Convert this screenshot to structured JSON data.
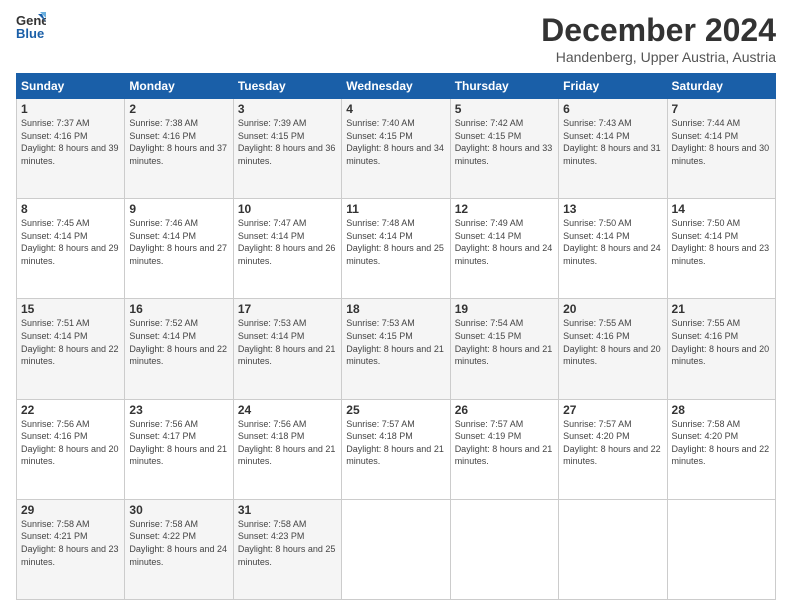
{
  "logo": {
    "line1": "General",
    "line2": "Blue"
  },
  "header": {
    "title": "December 2024",
    "subtitle": "Handenberg, Upper Austria, Austria"
  },
  "columns": [
    "Sunday",
    "Monday",
    "Tuesday",
    "Wednesday",
    "Thursday",
    "Friday",
    "Saturday"
  ],
  "weeks": [
    [
      {
        "day": "1",
        "sunrise": "7:37 AM",
        "sunset": "4:16 PM",
        "daylight": "8 hours and 39 minutes."
      },
      {
        "day": "2",
        "sunrise": "7:38 AM",
        "sunset": "4:16 PM",
        "daylight": "8 hours and 37 minutes."
      },
      {
        "day": "3",
        "sunrise": "7:39 AM",
        "sunset": "4:15 PM",
        "daylight": "8 hours and 36 minutes."
      },
      {
        "day": "4",
        "sunrise": "7:40 AM",
        "sunset": "4:15 PM",
        "daylight": "8 hours and 34 minutes."
      },
      {
        "day": "5",
        "sunrise": "7:42 AM",
        "sunset": "4:15 PM",
        "daylight": "8 hours and 33 minutes."
      },
      {
        "day": "6",
        "sunrise": "7:43 AM",
        "sunset": "4:14 PM",
        "daylight": "8 hours and 31 minutes."
      },
      {
        "day": "7",
        "sunrise": "7:44 AM",
        "sunset": "4:14 PM",
        "daylight": "8 hours and 30 minutes."
      }
    ],
    [
      {
        "day": "8",
        "sunrise": "7:45 AM",
        "sunset": "4:14 PM",
        "daylight": "8 hours and 29 minutes."
      },
      {
        "day": "9",
        "sunrise": "7:46 AM",
        "sunset": "4:14 PM",
        "daylight": "8 hours and 27 minutes."
      },
      {
        "day": "10",
        "sunrise": "7:47 AM",
        "sunset": "4:14 PM",
        "daylight": "8 hours and 26 minutes."
      },
      {
        "day": "11",
        "sunrise": "7:48 AM",
        "sunset": "4:14 PM",
        "daylight": "8 hours and 25 minutes."
      },
      {
        "day": "12",
        "sunrise": "7:49 AM",
        "sunset": "4:14 PM",
        "daylight": "8 hours and 24 minutes."
      },
      {
        "day": "13",
        "sunrise": "7:50 AM",
        "sunset": "4:14 PM",
        "daylight": "8 hours and 24 minutes."
      },
      {
        "day": "14",
        "sunrise": "7:50 AM",
        "sunset": "4:14 PM",
        "daylight": "8 hours and 23 minutes."
      }
    ],
    [
      {
        "day": "15",
        "sunrise": "7:51 AM",
        "sunset": "4:14 PM",
        "daylight": "8 hours and 22 minutes."
      },
      {
        "day": "16",
        "sunrise": "7:52 AM",
        "sunset": "4:14 PM",
        "daylight": "8 hours and 22 minutes."
      },
      {
        "day": "17",
        "sunrise": "7:53 AM",
        "sunset": "4:14 PM",
        "daylight": "8 hours and 21 minutes."
      },
      {
        "day": "18",
        "sunrise": "7:53 AM",
        "sunset": "4:15 PM",
        "daylight": "8 hours and 21 minutes."
      },
      {
        "day": "19",
        "sunrise": "7:54 AM",
        "sunset": "4:15 PM",
        "daylight": "8 hours and 21 minutes."
      },
      {
        "day": "20",
        "sunrise": "7:55 AM",
        "sunset": "4:16 PM",
        "daylight": "8 hours and 20 minutes."
      },
      {
        "day": "21",
        "sunrise": "7:55 AM",
        "sunset": "4:16 PM",
        "daylight": "8 hours and 20 minutes."
      }
    ],
    [
      {
        "day": "22",
        "sunrise": "7:56 AM",
        "sunset": "4:16 PM",
        "daylight": "8 hours and 20 minutes."
      },
      {
        "day": "23",
        "sunrise": "7:56 AM",
        "sunset": "4:17 PM",
        "daylight": "8 hours and 21 minutes."
      },
      {
        "day": "24",
        "sunrise": "7:56 AM",
        "sunset": "4:18 PM",
        "daylight": "8 hours and 21 minutes."
      },
      {
        "day": "25",
        "sunrise": "7:57 AM",
        "sunset": "4:18 PM",
        "daylight": "8 hours and 21 minutes."
      },
      {
        "day": "26",
        "sunrise": "7:57 AM",
        "sunset": "4:19 PM",
        "daylight": "8 hours and 21 minutes."
      },
      {
        "day": "27",
        "sunrise": "7:57 AM",
        "sunset": "4:20 PM",
        "daylight": "8 hours and 22 minutes."
      },
      {
        "day": "28",
        "sunrise": "7:58 AM",
        "sunset": "4:20 PM",
        "daylight": "8 hours and 22 minutes."
      }
    ],
    [
      {
        "day": "29",
        "sunrise": "7:58 AM",
        "sunset": "4:21 PM",
        "daylight": "8 hours and 23 minutes."
      },
      {
        "day": "30",
        "sunrise": "7:58 AM",
        "sunset": "4:22 PM",
        "daylight": "8 hours and 24 minutes."
      },
      {
        "day": "31",
        "sunrise": "7:58 AM",
        "sunset": "4:23 PM",
        "daylight": "8 hours and 25 minutes."
      },
      null,
      null,
      null,
      null
    ]
  ]
}
